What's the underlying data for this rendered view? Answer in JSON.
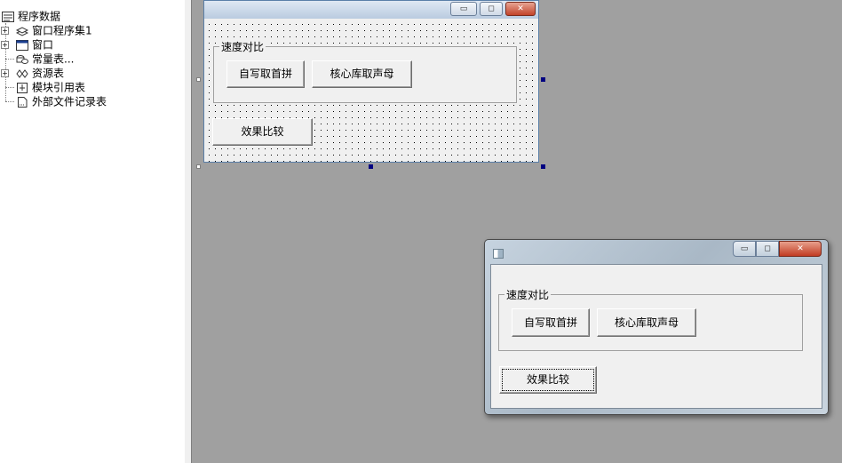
{
  "tree": {
    "root_label": "程序数据",
    "items": [
      {
        "label": "窗口程序集1",
        "icon": "assembly-icon",
        "expandable": true
      },
      {
        "label": "窗口",
        "icon": "window-icon",
        "expandable": true
      },
      {
        "label": "常量表...",
        "icon": "constants-icon",
        "expandable": false
      },
      {
        "label": "资源表",
        "icon": "resource-icon",
        "expandable": true
      },
      {
        "label": "模块引用表",
        "icon": "module-ref-icon",
        "expandable": false
      },
      {
        "label": "外部文件记录表",
        "icon": "file-record-icon",
        "expandable": false
      }
    ],
    "expand_glyph": "+"
  },
  "design_form": {
    "minimize_glyph": "▭",
    "maximize_glyph": "◻",
    "close_glyph": "✕",
    "group_label": "速度对比",
    "btn_self": "自写取首拼",
    "btn_core": "核心库取声母",
    "btn_compare": "效果比较"
  },
  "run_window": {
    "minimize_glyph": "▭",
    "maximize_glyph": "◻",
    "close_glyph": "✕",
    "group_label": "速度对比",
    "btn_self": "自写取首拼",
    "btn_core": "核心库取声母",
    "btn_compare": "效果比较"
  },
  "colors": {
    "workspace": "#a0a0a0",
    "selection_handle": "#000080",
    "close_button": "#c2432a"
  }
}
